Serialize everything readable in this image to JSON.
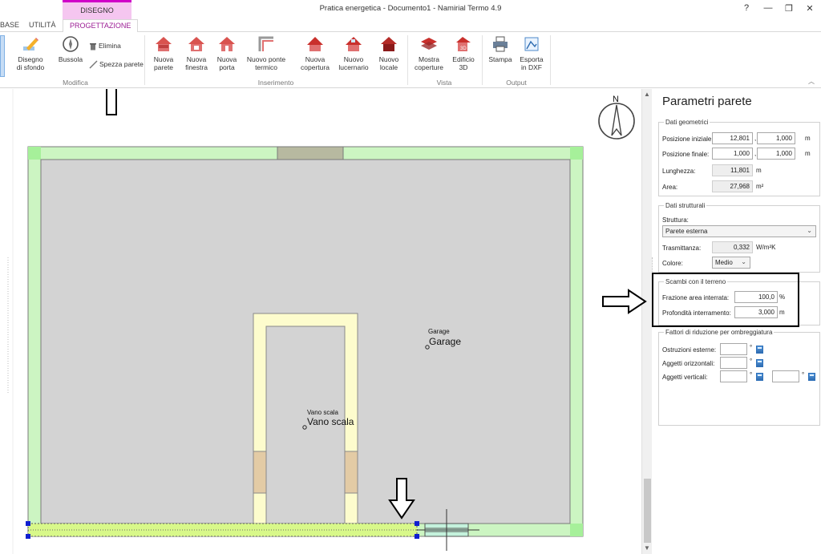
{
  "window": {
    "title": "Pratica energetica - Documento1 - Namirial Termo 4.9",
    "controls": [
      "?",
      "—",
      "❐",
      "✕"
    ]
  },
  "context_tab": "DISEGNO",
  "tabs": [
    {
      "label": "BASE",
      "active": false
    },
    {
      "label": "UTILITÀ",
      "active": false
    },
    {
      "label": "PROGETTAZIONE",
      "active": true
    }
  ],
  "ribbon": {
    "modifica": {
      "disegno_sfondo": "Disegno\ndi sfondo",
      "bussola": "Bussola",
      "elimina": "Elimina",
      "spezza_parete": "Spezza parete",
      "group": "Modifica"
    },
    "inserimento": {
      "nuova_parete": "Nuova\nparete",
      "nuova_finestra": "Nuova\nfinestra",
      "nuova_porta": "Nuova\nporta",
      "nuovo_ponte_termico": "Nuovo ponte\ntermico",
      "nuova_copertura": "Nuova\ncopertura",
      "nuovo_lucernario": "Nuovo\nlucernario",
      "nuovo_locale": "Nuovo\nlocale",
      "group": "Inserimento"
    },
    "vista": {
      "mostra_coperture": "Mostra\ncoperture",
      "edificio_3d": "Edificio\n3D",
      "group": "Vista"
    },
    "output": {
      "stampa": "Stampa",
      "esporta_dxf": "Esporta\nin DXF",
      "group": "Output"
    }
  },
  "canvas": {
    "compass_label": "N",
    "rooms": [
      {
        "small": "Garage",
        "big": "Garage"
      },
      {
        "small": "Vano scala",
        "big": "Vano scala"
      }
    ],
    "colors": {
      "room_fill": "#d3d3d3",
      "wall_fill": "#ccf5c2",
      "selected_wall": "#d8f88a",
      "stair_wall": "#fdfccd",
      "door": "#e3cba5",
      "window": "#b7b9a0"
    }
  },
  "panel": {
    "title": "Parametri parete",
    "dati_geometrici": {
      "legend": "Dati geometrici",
      "posizione_iniziale_label": "Posizione iniziale:",
      "posizione_iniziale_x": "12,801",
      "posizione_iniziale_y": "1,000",
      "posizione_finale_label": "Posizione finale:",
      "posizione_finale_x": "1,000",
      "posizione_finale_y": "1,000",
      "lunghezza_label": "Lunghezza:",
      "lunghezza": "11,801",
      "area_label": "Area:",
      "area": "27,968",
      "comma": ",",
      "unit_m": "m",
      "unit_m2": "m²"
    },
    "dati_strutturali": {
      "legend": "Dati strutturali",
      "struttura_label": "Struttura:",
      "struttura": "Parete esterna",
      "trasmittanza_label": "Trasmittanza:",
      "trasmittanza": "0,332",
      "trasmittanza_unit": "W/m²K",
      "colore_label": "Colore:",
      "colore": "Medio"
    },
    "scambi_terreno": {
      "legend": "Scambi con il terreno",
      "frazione_label": "Frazione area interrata:",
      "frazione": "100,0",
      "frazione_unit": "%",
      "profondita_label": "Profondità interramento:",
      "profondita": "3,000",
      "profondita_unit": "m"
    },
    "ombreggiatura": {
      "legend": "Fattori di riduzione per ombreggiatura",
      "ostruzioni_label": "Ostruzioni esterne:",
      "aggetti_orizz_label": "Aggetti orizzontali:",
      "aggetti_vert_label": "Aggetti verticali:",
      "degree": "°"
    }
  }
}
